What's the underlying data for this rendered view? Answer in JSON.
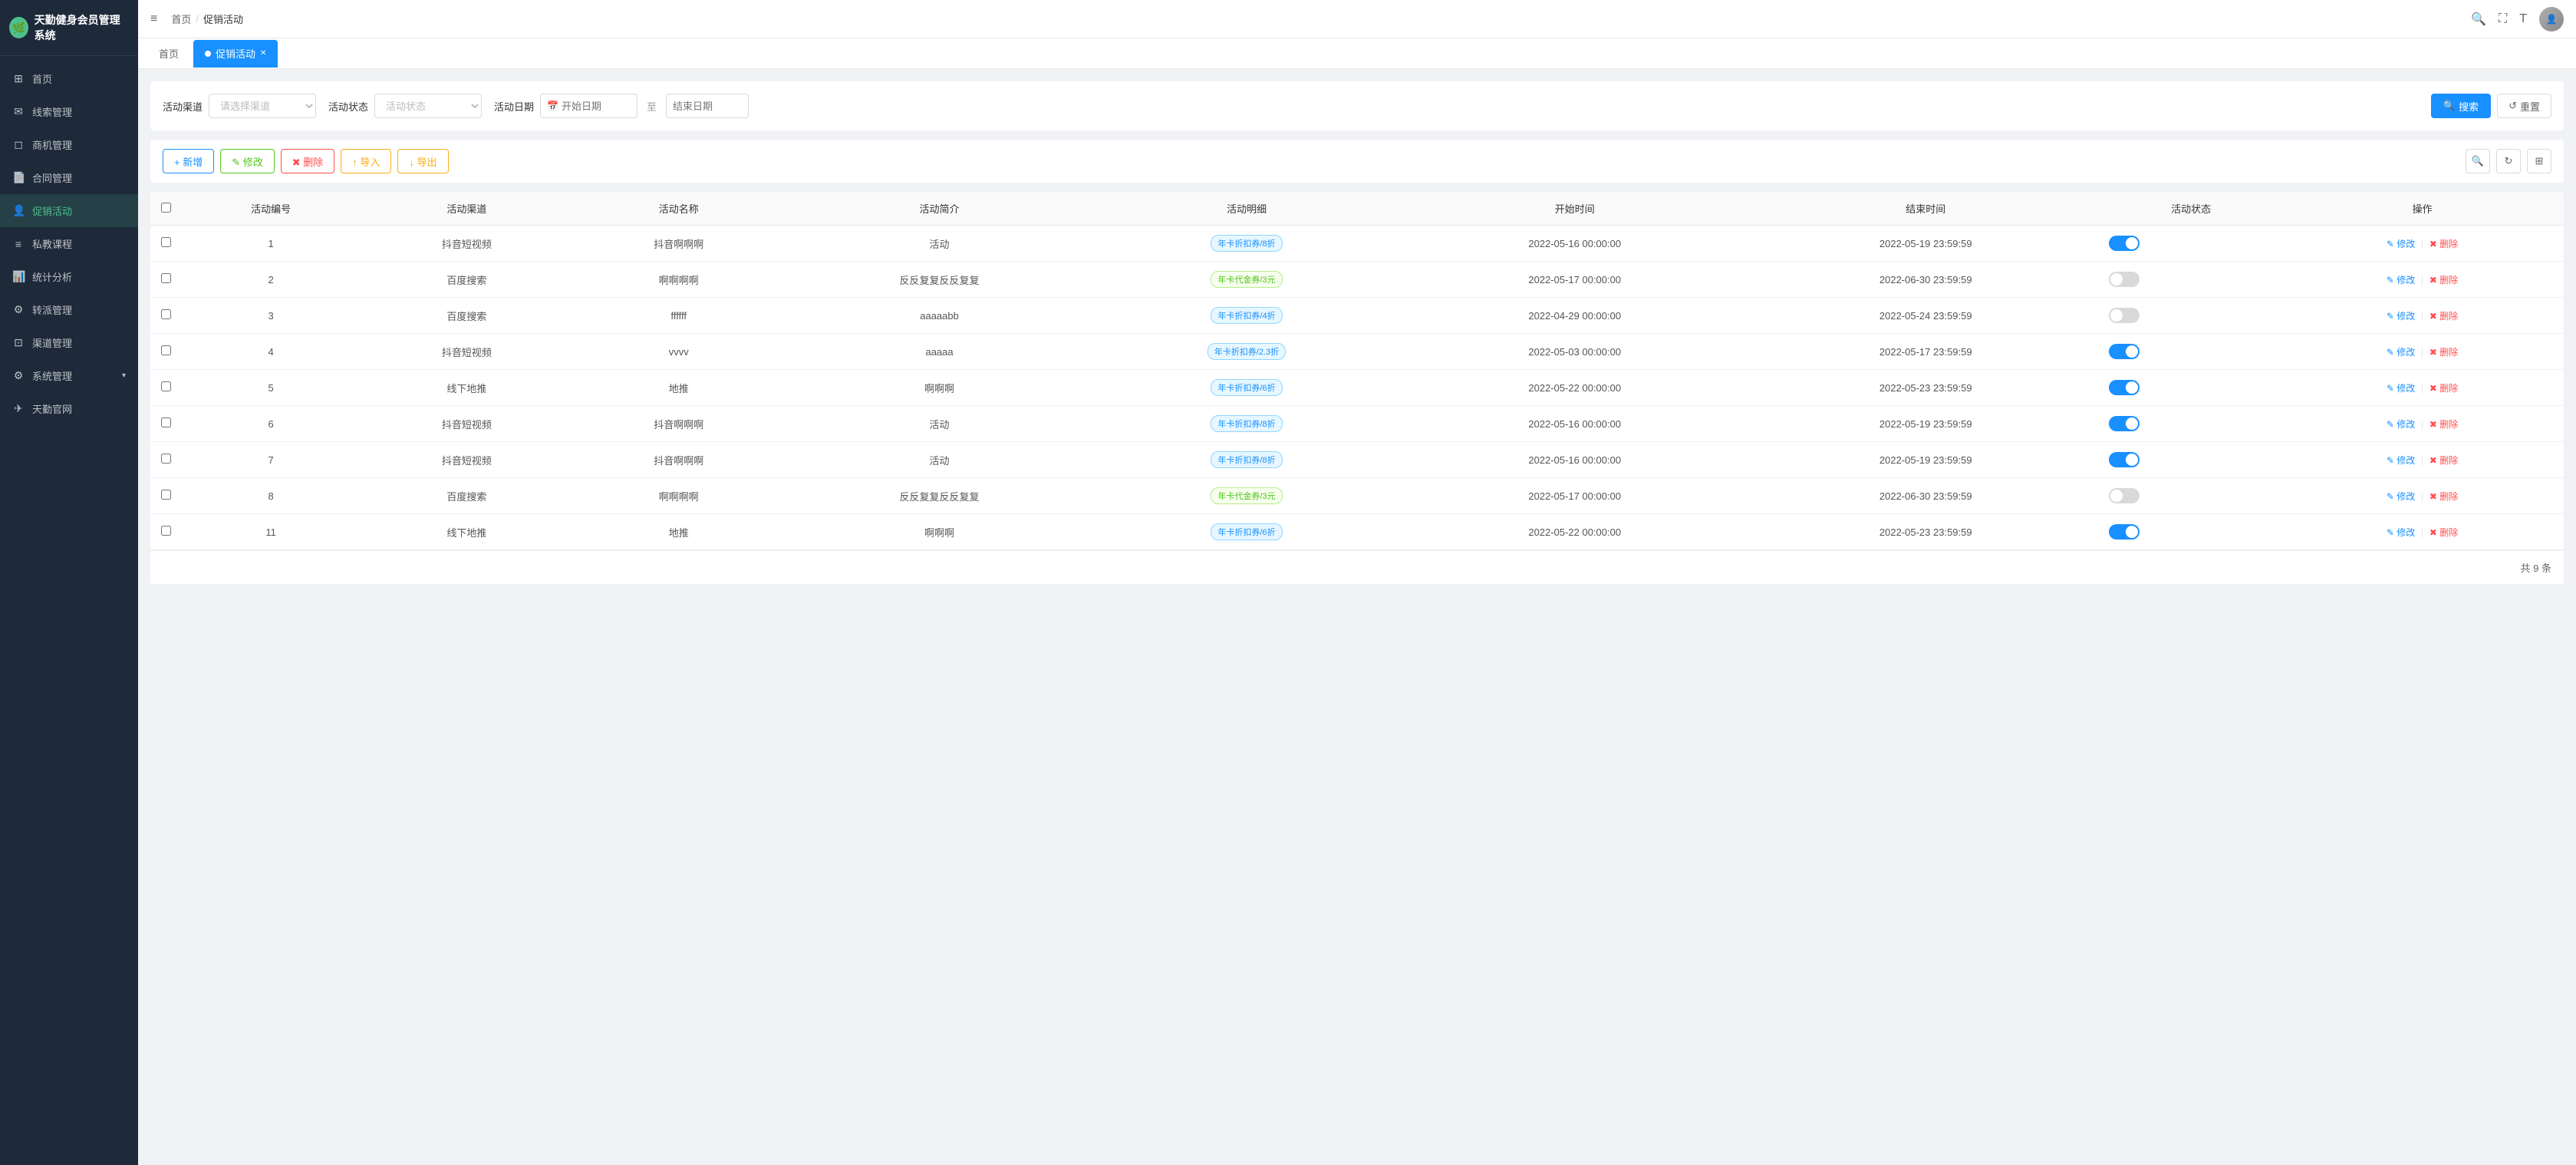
{
  "app": {
    "title": "天勤健身会员管理系统",
    "logo_icon": "🌿"
  },
  "sidebar": {
    "items": [
      {
        "id": "home",
        "label": "首页",
        "icon": "⊞",
        "active": false
      },
      {
        "id": "leads",
        "label": "线索管理",
        "icon": "✉",
        "active": false
      },
      {
        "id": "opportunity",
        "label": "商机管理",
        "icon": "◻",
        "active": false
      },
      {
        "id": "contract",
        "label": "合同管理",
        "icon": "📄",
        "active": false
      },
      {
        "id": "promotion",
        "label": "促销活动",
        "icon": "👤",
        "active": true
      },
      {
        "id": "private-course",
        "label": "私教课程",
        "icon": "≡",
        "active": false
      },
      {
        "id": "stats",
        "label": "统计分析",
        "icon": "📊",
        "active": false
      },
      {
        "id": "dispatch",
        "label": "转派管理",
        "icon": "⚙",
        "active": false
      },
      {
        "id": "channel",
        "label": "渠道管理",
        "icon": "⊡",
        "active": false
      },
      {
        "id": "system",
        "label": "系统管理",
        "icon": "⚙",
        "active": false,
        "has_arrow": true
      },
      {
        "id": "website",
        "label": "天勤官网",
        "icon": "✈",
        "active": false
      }
    ]
  },
  "header": {
    "breadcrumb": {
      "home": "首页",
      "sep": "/",
      "current": "促销活动"
    },
    "menu_icon": "≡"
  },
  "tabs": [
    {
      "id": "home-tab",
      "label": "首页",
      "active": false,
      "closable": false
    },
    {
      "id": "promotion-tab",
      "label": "促销活动",
      "active": true,
      "closable": true
    }
  ],
  "filter": {
    "channel_label": "活动渠道",
    "channel_placeholder": "请选择渠道",
    "status_label": "活动状态",
    "status_placeholder": "活动状态",
    "date_label": "活动日期",
    "start_placeholder": "开始日期",
    "to_text": "至",
    "end_placeholder": "结束日期",
    "search_btn": "搜索",
    "reset_btn": "重置"
  },
  "actions": {
    "add": "+ 新增",
    "edit": "✎ 修改",
    "delete": "✖ 删除",
    "import": "↑ 导入",
    "export": "↓ 导出"
  },
  "table": {
    "columns": [
      "活动编号",
      "活动渠道",
      "活动名称",
      "活动简介",
      "活动明细",
      "开始时间",
      "结束时间",
      "活动状态",
      "操作"
    ],
    "rows": [
      {
        "id": 1,
        "channel": "抖音短视频",
        "name": "抖音啊啊啊",
        "desc": "活动",
        "detail": "年卡折扣券/8折",
        "detail_type": "blue",
        "start": "2022-05-16 00:00:00",
        "end": "2022-05-19 23:59:59",
        "status_on": true
      },
      {
        "id": 2,
        "channel": "百度搜索",
        "name": "啊啊啊啊",
        "desc": "反反复复反反复复",
        "detail": "年卡代金券/3元",
        "detail_type": "green",
        "start": "2022-05-17 00:00:00",
        "end": "2022-06-30 23:59:59",
        "status_on": false
      },
      {
        "id": 3,
        "channel": "百度搜索",
        "name": "ffffff",
        "desc": "aaaaabb",
        "detail": "年卡折扣券/4折",
        "detail_type": "blue",
        "start": "2022-04-29 00:00:00",
        "end": "2022-05-24 23:59:59",
        "status_on": false
      },
      {
        "id": 4,
        "channel": "抖音短视频",
        "name": "vvvv",
        "desc": "aaaaa",
        "detail": "年卡折扣券/2.3折",
        "detail_type": "blue",
        "start": "2022-05-03 00:00:00",
        "end": "2022-05-17 23:59:59",
        "status_on": true
      },
      {
        "id": 5,
        "channel": "线下地推",
        "name": "地推",
        "desc": "啊啊啊",
        "detail": "年卡折扣券/6折",
        "detail_type": "blue",
        "start": "2022-05-22 00:00:00",
        "end": "2022-05-23 23:59:59",
        "status_on": true
      },
      {
        "id": 6,
        "channel": "抖音短视频",
        "name": "抖音啊啊啊",
        "desc": "活动",
        "detail": "年卡折扣券/8折",
        "detail_type": "blue",
        "start": "2022-05-16 00:00:00",
        "end": "2022-05-19 23:59:59",
        "status_on": true
      },
      {
        "id": 7,
        "channel": "抖音短视频",
        "name": "抖音啊啊啊",
        "desc": "活动",
        "detail": "年卡折扣券/8折",
        "detail_type": "blue",
        "start": "2022-05-16 00:00:00",
        "end": "2022-05-19 23:59:59",
        "status_on": true
      },
      {
        "id": 8,
        "channel": "百度搜索",
        "name": "啊啊啊啊",
        "desc": "反反复复反反复复",
        "detail": "年卡代金券/3元",
        "detail_type": "green",
        "start": "2022-05-17 00:00:00",
        "end": "2022-06-30 23:59:59",
        "status_on": false
      },
      {
        "id": 11,
        "channel": "线下地推",
        "name": "地推",
        "desc": "啊啊啊",
        "detail": "年卡折扣券/6折",
        "detail_type": "blue",
        "start": "2022-05-22 00:00:00",
        "end": "2022-05-23 23:59:59",
        "status_on": true
      }
    ],
    "op_edit": "✎ 修改",
    "op_delete": "✖ 删除"
  },
  "pagination": {
    "total_text": "共 9 条"
  }
}
